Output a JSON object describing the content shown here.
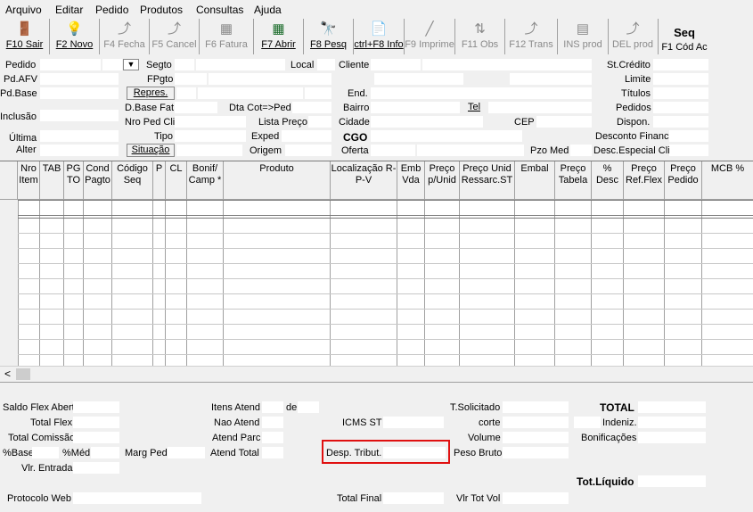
{
  "menu": [
    "Arquivo",
    "Editar",
    "Pedido",
    "Produtos",
    "Consultas",
    "Ajuda"
  ],
  "toolbar": [
    {
      "label": "F10 Sair",
      "icon": "exit-icon",
      "enabled": true
    },
    {
      "label": "F2 Novo",
      "icon": "lightbulb-icon",
      "enabled": true
    },
    {
      "label": "F4 Fecha",
      "icon": "close-order-icon",
      "enabled": false
    },
    {
      "label": "F5 Cancel",
      "icon": "cancel-icon",
      "enabled": false
    },
    {
      "label": "F6 Fatura",
      "icon": "invoice-icon",
      "enabled": false
    },
    {
      "label": "F7 Abrir",
      "icon": "open-grid-icon",
      "enabled": true
    },
    {
      "label": "F8 Pesq",
      "icon": "binoculars-icon",
      "enabled": true
    },
    {
      "label": "ctrl+F8 Info",
      "icon": "info-doc-icon",
      "enabled": true
    },
    {
      "label": "F9 Imprime",
      "icon": "print-icon",
      "enabled": false
    },
    {
      "label": "F11 Obs",
      "icon": "obs-icon",
      "enabled": false
    },
    {
      "label": "F12 Trans",
      "icon": "transfer-icon",
      "enabled": false
    },
    {
      "label": "INS prod",
      "icon": "insert-product-icon",
      "enabled": false
    },
    {
      "label": "DEL prod",
      "icon": "delete-product-icon",
      "enabled": false
    }
  ],
  "seq": {
    "title": "Seq",
    "label": "F1 Cód Ac"
  },
  "header": {
    "pedido": "Pedido",
    "segto": "Segto",
    "local": "Local",
    "cliente": "Cliente",
    "st_credito": "St.Crédito",
    "pd_afv": "Pd.AFV",
    "fpgto": "FPgto",
    "limite": "Limite",
    "pd_base": "Pd.Base",
    "repres": "Repres.",
    "end": "End.",
    "titulos": "Títulos",
    "d_base_fat": "D.Base Fat",
    "dta_cot_ped": "Dta Cot=>Ped",
    "bairro": "Bairro",
    "tel": "Tel",
    "pedidos": "Pedidos",
    "inclusao": "Inclusão",
    "nro_ped_cli": "Nro Ped Cli",
    "lista_preco": "Lista Preço",
    "cidade": "Cidade",
    "cep": "CEP",
    "dispon": "Dispon.",
    "ultima": "Última",
    "tipo": "Tipo",
    "exped": "Exped",
    "cgo": "CGO",
    "desconto_financ": "Desconto Financ.",
    "alter": "Alter",
    "situacao": "Situação",
    "origem": "Origem",
    "oferta": "Oferta",
    "pzo_med": "Pzo Med",
    "desc_especial": "Desc.Especial Cli."
  },
  "grid": {
    "columns": [
      "Nro Item",
      "TAB",
      "PG TO",
      "Cond Pagto",
      "Código Seq",
      "P",
      "CL",
      "Bonif/ Camp *",
      "Produto",
      "Localização R-P-V",
      "Emb Vda",
      "Preço p/Unid",
      "Preço Unid Ressarc.ST",
      "Embal",
      "Preço Tabela",
      "% Desc",
      "Preço Ref.Flex",
      "Preço Pedido",
      "MCB %"
    ],
    "scroll_left": "<"
  },
  "totals": {
    "saldo_flex": "Saldo Flex Abert",
    "total_flex": "Total Flex",
    "total_comissao": "Total Comissão",
    "pct_base": "%Base",
    "pct_med": "%Méd.",
    "marg_ped": "Marg Ped",
    "vlr_entrada": "Vlr. Entrada",
    "itens_atend": "Itens Atend",
    "de": "de",
    "nao_atend": "Nao Atend",
    "atend_parc": "Atend Parc",
    "atend_total": "Atend Total",
    "icms_st": "ICMS ST",
    "desp_tribut": "Desp. Tribut.",
    "t_solicitado": "T.Solicitado",
    "corte": "corte",
    "volume": "Volume",
    "peso_bruto": "Peso Bruto",
    "total": "TOTAL",
    "indeniz": "Indeniz.",
    "bonificacoes": "Bonificações",
    "tot_liquido": "Tot.Líquido",
    "protocolo_web": "Protocolo Web",
    "total_final": "Total Final",
    "vlr_tot_vol": "Vlr Tot Vol"
  }
}
